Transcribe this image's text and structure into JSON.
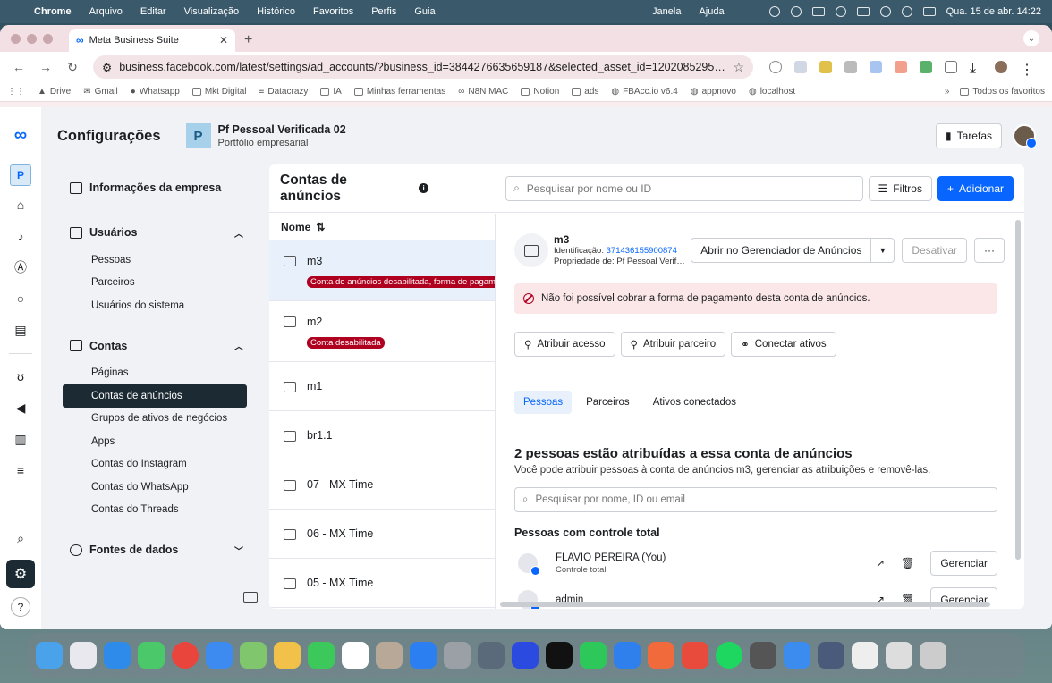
{
  "menubar": {
    "app": "Chrome",
    "items": [
      "Arquivo",
      "Editar",
      "Visualização",
      "Histórico",
      "Favoritos",
      "Perfis",
      "Guia"
    ],
    "right": [
      "Janela",
      "Ajuda"
    ],
    "clock": "Qua. 15 de abr.  14:22"
  },
  "browser": {
    "tab_title": "Meta Business Suite",
    "url": "business.facebook.com/latest/settings/ad_accounts/?business_id=3844276635659187&selected_asset_id=1202085295159…",
    "bookmarks": [
      "Drive",
      "Gmail",
      "Whatsapp",
      "Mkt Digital",
      "Datacrazy",
      "IA",
      "Minhas ferramentas",
      "N8N MAC",
      "Notion",
      "ads",
      "FBAcc.io v6.4",
      "appnovo",
      "localhost"
    ],
    "all_bookmarks": "Todos os favoritos"
  },
  "header": {
    "title": "Configurações",
    "portfolio_initial": "P",
    "portfolio_name": "Pf Pessoal Verificada 02",
    "portfolio_sub": "Portfólio empresarial",
    "tasks_label": "Tarefas"
  },
  "rail": {
    "profile_initial": "P"
  },
  "leftnav": {
    "company_info": "Informações da empresa",
    "users": {
      "label": "Usuários",
      "items": [
        "Pessoas",
        "Parceiros",
        "Usuários do sistema"
      ]
    },
    "accounts": {
      "label": "Contas",
      "items": [
        "Páginas",
        "Contas de anúncios",
        "Grupos de ativos de negócios",
        "Apps",
        "Contas do Instagram",
        "Contas do WhatsApp",
        "Contas do Threads"
      ]
    },
    "data_sources": "Fontes de dados"
  },
  "main": {
    "title": "Contas de anúncios",
    "search_placeholder": "Pesquisar por nome ou ID",
    "filters_label": "Filtros",
    "add_label": "Adicionar",
    "list_header": "Nome",
    "accounts": [
      {
        "name": "m3",
        "badge": "Conta de anúncios desabilitada, forma de pagamento"
      },
      {
        "name": "m2",
        "badge": "Conta desabilitada"
      },
      {
        "name": "m1"
      },
      {
        "name": "br1.1"
      },
      {
        "name": "07 - MX Time"
      },
      {
        "name": "06 - MX Time"
      },
      {
        "name": "05 - MX Time"
      }
    ]
  },
  "detail": {
    "name": "m3",
    "id_label": "Identificação:",
    "id_value": "371436155900874",
    "owner": "Propriedade de: Pf Pessoal Verif…",
    "open_manager": "Abrir no Gerenciador de Anúncios",
    "deactivate": "Desativar",
    "more": "···",
    "alert": "Não foi possível cobrar a forma de pagamento desta conta de anúncios.",
    "assign_access": "Atribuir acesso",
    "assign_partner": "Atribuir parceiro",
    "connect_assets": "Conectar ativos",
    "tabs": [
      "Pessoas",
      "Parceiros",
      "Ativos conectados"
    ],
    "section_title": "2 pessoas estão atribuídas a essa conta de anúncios",
    "section_sub": "Você pode atribuir pessoas à conta de anúncios m3, gerenciar as atribuições e removê-las.",
    "people_search_placeholder": "Pesquisar por nome, ID ou email",
    "full_control_title": "Pessoas com controle total",
    "people": [
      {
        "name": "FLAVIO PEREIRA (You)",
        "role": "Controle total",
        "manage": "Gerenciar"
      },
      {
        "name": "admin",
        "role": "",
        "manage": "Gerenciar"
      }
    ]
  }
}
